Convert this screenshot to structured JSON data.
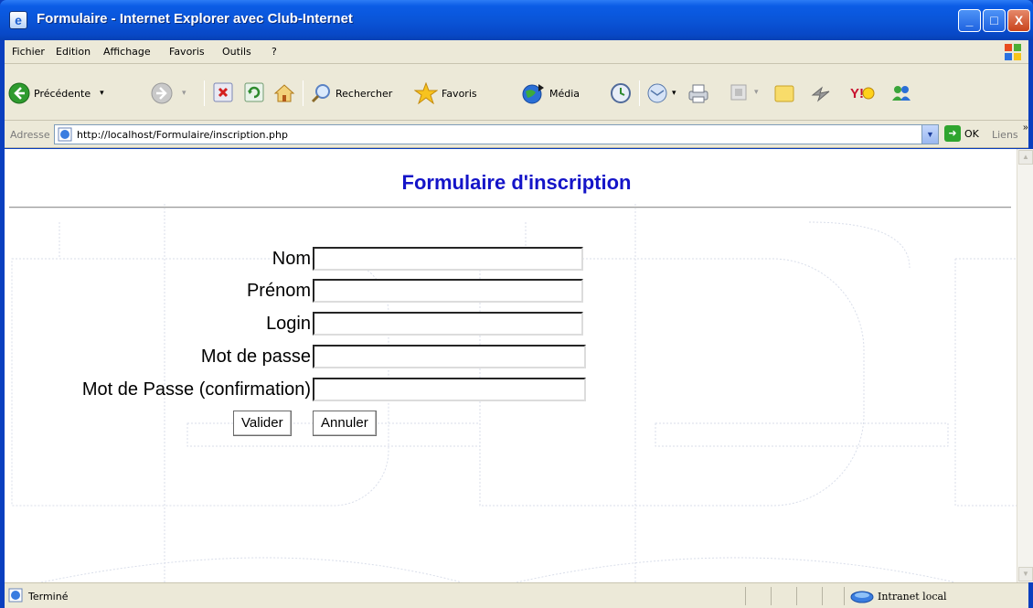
{
  "window": {
    "title": "Formulaire - Internet Explorer avec Club-Internet",
    "controls": {
      "minimize": "_",
      "maximize": "□",
      "close": "X"
    }
  },
  "menu": {
    "items": [
      "Fichier",
      "Edition",
      "Affichage",
      "Favoris",
      "Outils",
      "?"
    ]
  },
  "toolbar": {
    "back_label": "Précédente",
    "search_label": "Rechercher",
    "favorites_label": "Favoris",
    "media_label": "Média",
    "dropdown_arrow": "▾"
  },
  "address": {
    "label": "Adresse",
    "url": "http://localhost/Formulaire/inscription.php",
    "go_label": "OK",
    "links_label": "Liens",
    "dropdown_arrow": "▼",
    "overflow": "»"
  },
  "page": {
    "title": "Formulaire d'inscription",
    "fields": [
      {
        "label": "Nom",
        "value": ""
      },
      {
        "label": "Prénom",
        "value": ""
      },
      {
        "label": "Login",
        "value": ""
      },
      {
        "label": "Mot de passe",
        "value": ""
      },
      {
        "label": "Mot de Passe (confirmation)",
        "value": ""
      }
    ],
    "submit_label": "Valider",
    "reset_label": "Annuler"
  },
  "status": {
    "text": "Terminé",
    "zone": "Intranet local"
  },
  "colors": {
    "title_blue": "#1414c8",
    "xp_blue": "#0a55d8",
    "chrome": "#ece9d8"
  }
}
